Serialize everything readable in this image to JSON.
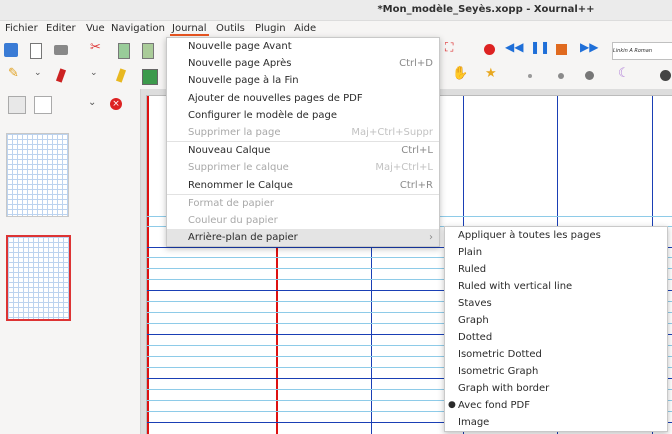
{
  "window": {
    "title": "*Mon_modèle_Seyès.xopp - Xournal++"
  },
  "menubar": [
    {
      "label": "Fichier"
    },
    {
      "label": "Editer"
    },
    {
      "label": "Vue"
    },
    {
      "label": "Navigation"
    },
    {
      "label": "Journal"
    },
    {
      "label": "Outils"
    },
    {
      "label": "Plugin"
    },
    {
      "label": "Aide"
    }
  ],
  "journal_menu": [
    {
      "label": "Nouvelle page Avant",
      "shortcut": "",
      "disabled": false
    },
    {
      "label": "Nouvelle page Après",
      "shortcut": "Ctrl+D",
      "disabled": false
    },
    {
      "label": "Nouvelle page à la Fin",
      "shortcut": "",
      "disabled": false
    },
    {
      "label": "Ajouter de nouvelles pages de PDF",
      "shortcut": "",
      "disabled": false
    },
    {
      "label": "Configurer le modèle de page",
      "shortcut": "",
      "disabled": false
    },
    {
      "label": "Supprimer la page",
      "shortcut": "Maj+Ctrl+Suppr",
      "disabled": true
    },
    {
      "label": "Nouveau Calque",
      "shortcut": "Ctrl+L",
      "disabled": false
    },
    {
      "label": "Supprimer le calque",
      "shortcut": "Maj+Ctrl+L",
      "disabled": true
    },
    {
      "label": "Renommer le Calque",
      "shortcut": "Ctrl+R",
      "disabled": false
    },
    {
      "label": "Format de papier",
      "shortcut": "",
      "disabled": true
    },
    {
      "label": "Couleur du papier",
      "shortcut": "",
      "disabled": true
    },
    {
      "label": "Arrière-plan de papier",
      "shortcut": "›",
      "disabled": false
    }
  ],
  "background_submenu": [
    {
      "label": "Appliquer à toutes les pages",
      "selected": false
    },
    {
      "label": "Plain",
      "selected": false
    },
    {
      "label": "Ruled",
      "selected": false
    },
    {
      "label": "Ruled with vertical line",
      "selected": false
    },
    {
      "label": "Staves",
      "selected": false
    },
    {
      "label": "Graph",
      "selected": false
    },
    {
      "label": "Dotted",
      "selected": false
    },
    {
      "label": "Isometric Dotted",
      "selected": false
    },
    {
      "label": "Isometric Graph",
      "selected": false
    },
    {
      "label": "Graph with border",
      "selected": false
    },
    {
      "label": "Avec fond PDF",
      "selected": true
    },
    {
      "label": "Image",
      "selected": false
    }
  ],
  "toolbar": {
    "font_preview": "Linkin A Roman"
  },
  "colors": {
    "accent": "#e95420",
    "red": "#d11",
    "blue_line": "#1a3fb5",
    "light_line": "#8ecbe8"
  }
}
